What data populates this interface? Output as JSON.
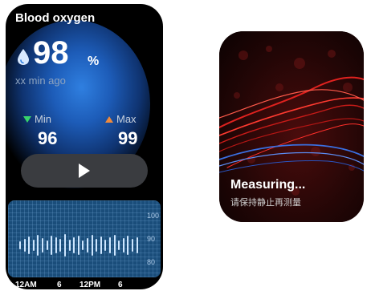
{
  "left_screen": {
    "title": "Blood oxygen",
    "current": {
      "value": "98",
      "unit": "%",
      "icon": "drop-icon"
    },
    "time_ago": "xx min ago",
    "min": {
      "label": "Min",
      "value": "96",
      "icon": "triangle-down-icon",
      "color": "#38d46b"
    },
    "max": {
      "label": "Max",
      "value": "99",
      "icon": "triangle-up-icon",
      "color": "#f08a3c"
    },
    "start_button": {
      "icon": "play-icon"
    },
    "history": {
      "y_ticks": [
        "100",
        "90",
        "80"
      ],
      "x_ticks": [
        "12AM",
        "6",
        "12PM",
        "6"
      ],
      "accent": "#1a4d7a"
    }
  },
  "right_screen": {
    "status": "Measuring...",
    "hint": "请保持静止再测量"
  }
}
